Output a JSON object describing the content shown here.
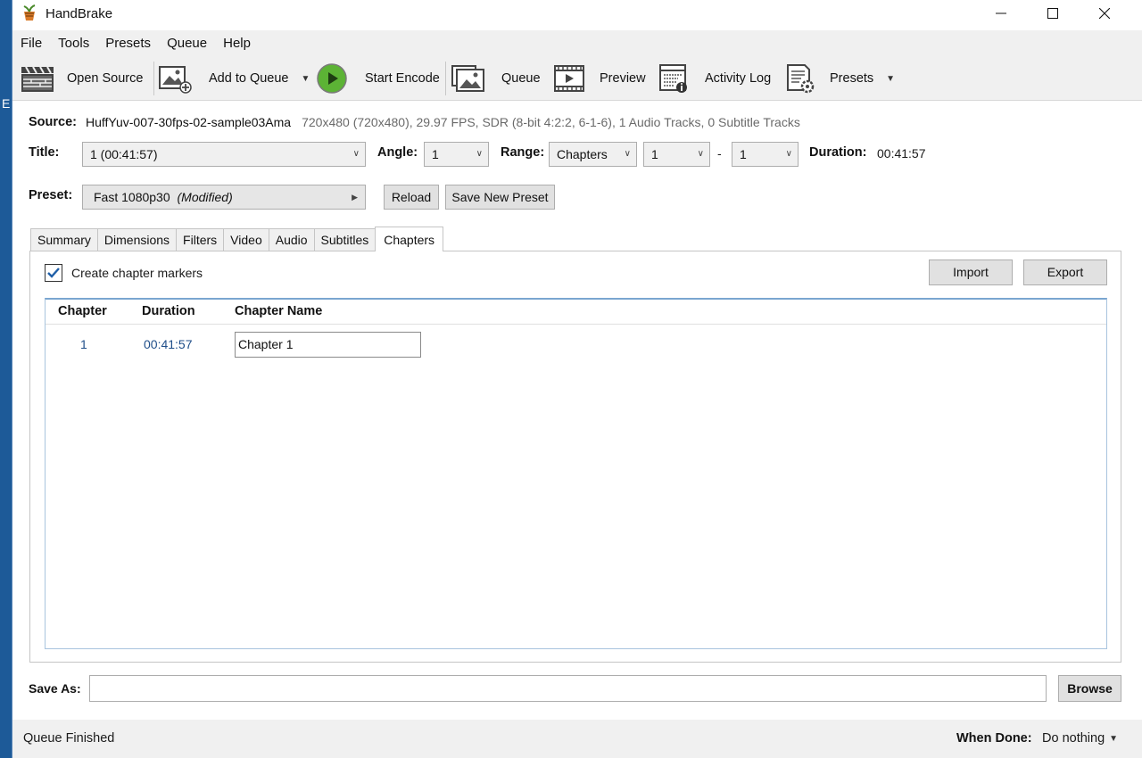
{
  "desktop": {
    "edge_char": "E"
  },
  "window": {
    "title": "HandBrake",
    "minimize_icon": "minimize-icon",
    "maximize_icon": "maximize-icon",
    "close_icon": "close-icon"
  },
  "menu": [
    "File",
    "Tools",
    "Presets",
    "Queue",
    "Help"
  ],
  "toolbar": {
    "open_source": "Open Source",
    "add_to_queue": "Add to Queue",
    "start_encode": "Start Encode",
    "queue": "Queue",
    "preview": "Preview",
    "activity_log": "Activity Log",
    "presets": "Presets"
  },
  "source": {
    "label": "Source:",
    "name": "HuffYuv-007-30fps-02-sample03Ama",
    "info": "720x480 (720x480), 29.97 FPS, SDR (8-bit 4:2:2, 6-1-6), 1 Audio Tracks, 0 Subtitle Tracks"
  },
  "title_row": {
    "title_label": "Title:",
    "title_value": "1  (00:41:57)",
    "angle_label": "Angle:",
    "angle_value": "1",
    "range_label": "Range:",
    "range_type": "Chapters",
    "range_start": "1",
    "range_dash": "-",
    "range_end": "1",
    "duration_label": "Duration:",
    "duration_value": "00:41:57"
  },
  "preset": {
    "label": "Preset:",
    "name": "Fast 1080p30",
    "modified": "(Modified)",
    "reload": "Reload",
    "save_new": "Save New Preset"
  },
  "tabs": [
    "Summary",
    "Dimensions",
    "Filters",
    "Video",
    "Audio",
    "Subtitles",
    "Chapters"
  ],
  "active_tab": "Chapters",
  "chapters": {
    "create_markers_label": "Create chapter markers",
    "create_markers_checked": true,
    "import": "Import",
    "export": "Export",
    "columns": [
      "Chapter",
      "Duration",
      "Chapter Name"
    ],
    "rows": [
      {
        "chapter": "1",
        "duration": "00:41:57",
        "name": "Chapter 1"
      }
    ]
  },
  "save_as": {
    "label": "Save As:",
    "value": "",
    "browse": "Browse"
  },
  "status": {
    "text": "Queue Finished",
    "when_done_label": "When Done:",
    "when_done_value": "Do nothing"
  },
  "colors": {
    "accent_blue": "#1f4e89",
    "play_green": "#5cb335",
    "chrome": "#f0f0f0"
  }
}
